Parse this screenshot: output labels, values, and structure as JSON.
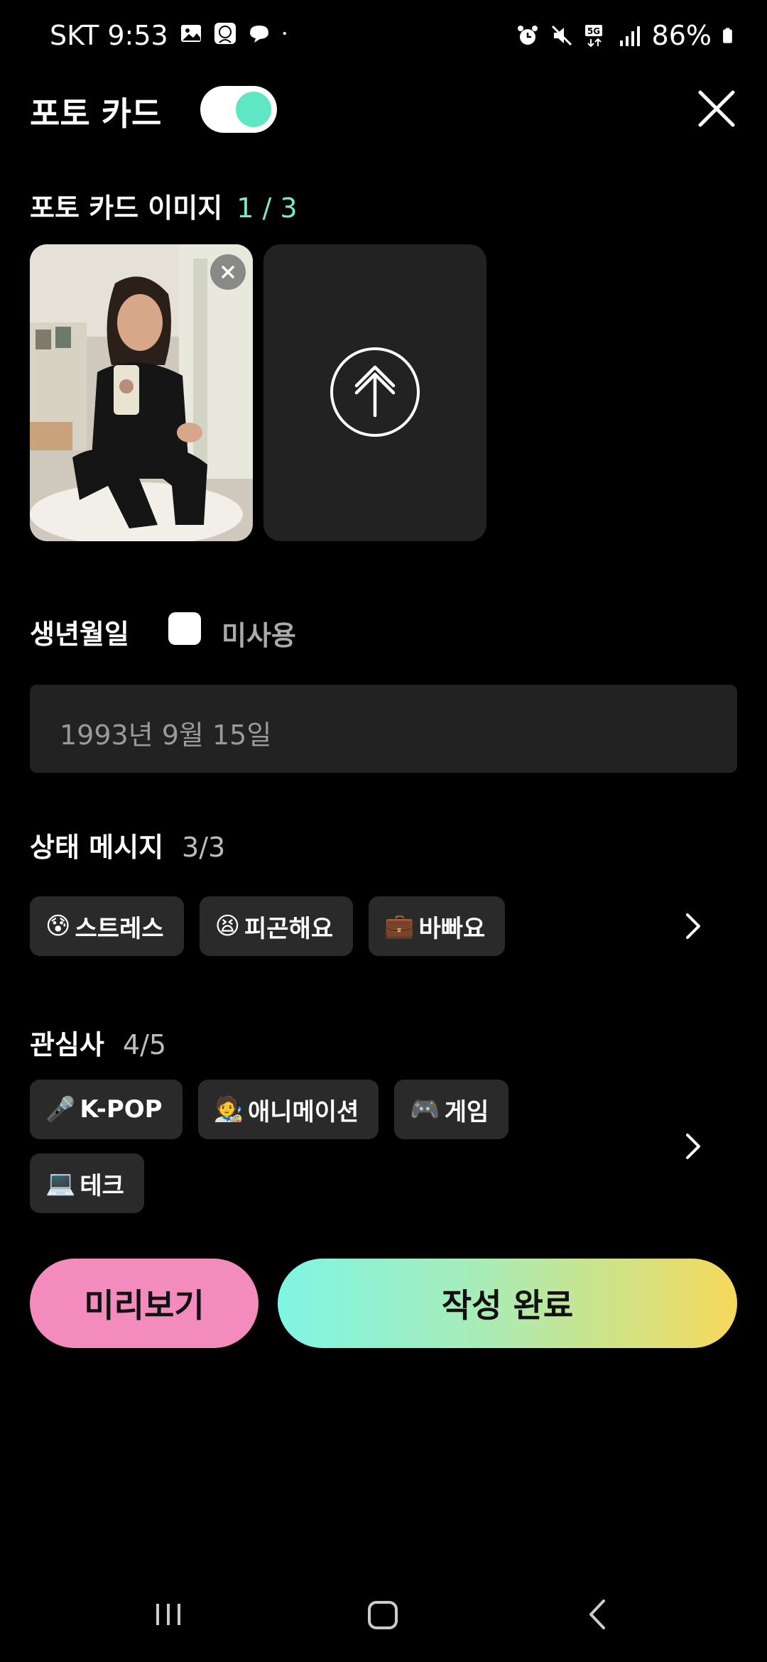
{
  "status_bar": {
    "carrier_time": "SKT 9:53",
    "battery": "86%",
    "network": "5G"
  },
  "header": {
    "title": "포토 카드",
    "toggle_on": true
  },
  "photo_section": {
    "label": "포토 카드 이미지",
    "count": "1 / 3"
  },
  "birthday": {
    "label": "생년월일",
    "unused_label": "미사용",
    "value": "1993년 9월 15일"
  },
  "status_message": {
    "label": "상태 메시지",
    "count": "3/3",
    "chips": [
      {
        "emoji": "😰",
        "label": "스트레스"
      },
      {
        "emoji": "😫",
        "label": "피곤해요"
      },
      {
        "emoji": "💼",
        "label": "바빠요"
      }
    ]
  },
  "interests": {
    "label": "관심사",
    "count": "4/5",
    "chips": [
      {
        "emoji": "🎤",
        "label": "K-POP"
      },
      {
        "emoji": "🧑‍🎨",
        "label": "애니메이션"
      },
      {
        "emoji": "🎮",
        "label": "게임"
      },
      {
        "emoji": "💻",
        "label": "테크"
      }
    ]
  },
  "buttons": {
    "preview": "미리보기",
    "done": "작성 완료"
  },
  "colors": {
    "accent": "#7de8c9",
    "preview_button": "#f48bbd",
    "gradient_start": "#7ff5e4",
    "gradient_end": "#f6d95a"
  }
}
